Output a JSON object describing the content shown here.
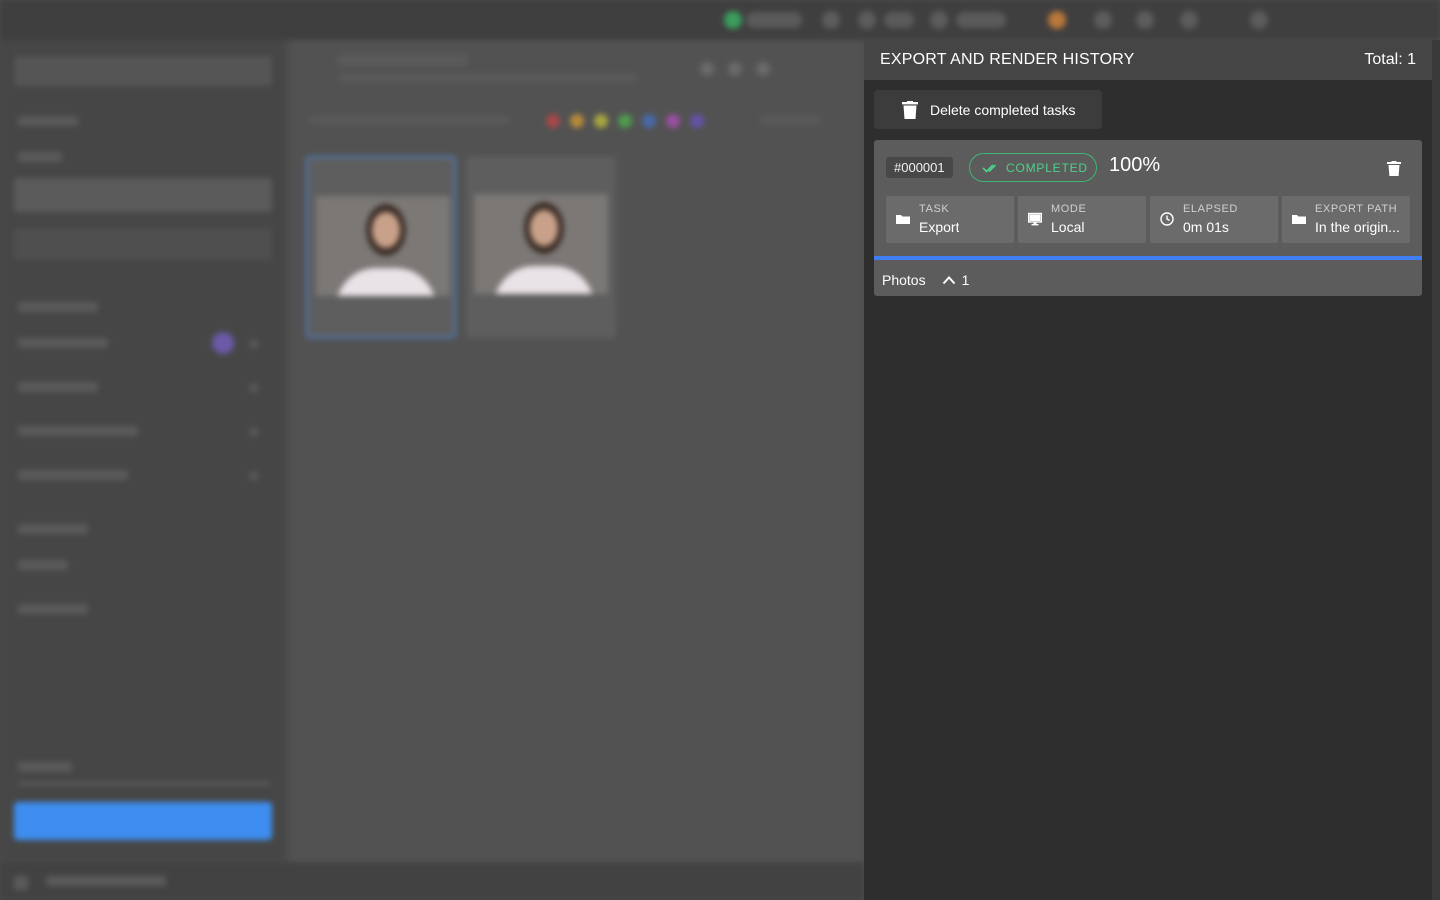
{
  "panel": {
    "title": "EXPORT AND RENDER HISTORY",
    "total_label": "Total: 1",
    "delete_completed_label": "Delete completed tasks"
  },
  "tasks": [
    {
      "id": "#000001",
      "status": "COMPLETED",
      "percent": "100%",
      "progress": 1.0,
      "info": {
        "task": {
          "label": "TASK",
          "value": "Export",
          "icon": "folder-icon"
        },
        "mode": {
          "label": "MODE",
          "value": "Local",
          "icon": "monitor-icon"
        },
        "elapsed": {
          "label": "ELAPSED",
          "value": "0m 01s",
          "icon": "clock-icon"
        },
        "export_path": {
          "label": "EXPORT PATH",
          "value": "In the origin...",
          "icon": "folder-icon"
        }
      },
      "photos_label": "Photos",
      "photos_count": "1"
    }
  ],
  "colors": {
    "panel_bg": "#2e2e2e",
    "header_bg": "#454545",
    "card_bg": "#5c5c5c",
    "status_green": "#4cd28a",
    "progress_blue": "#3f7ff3"
  }
}
